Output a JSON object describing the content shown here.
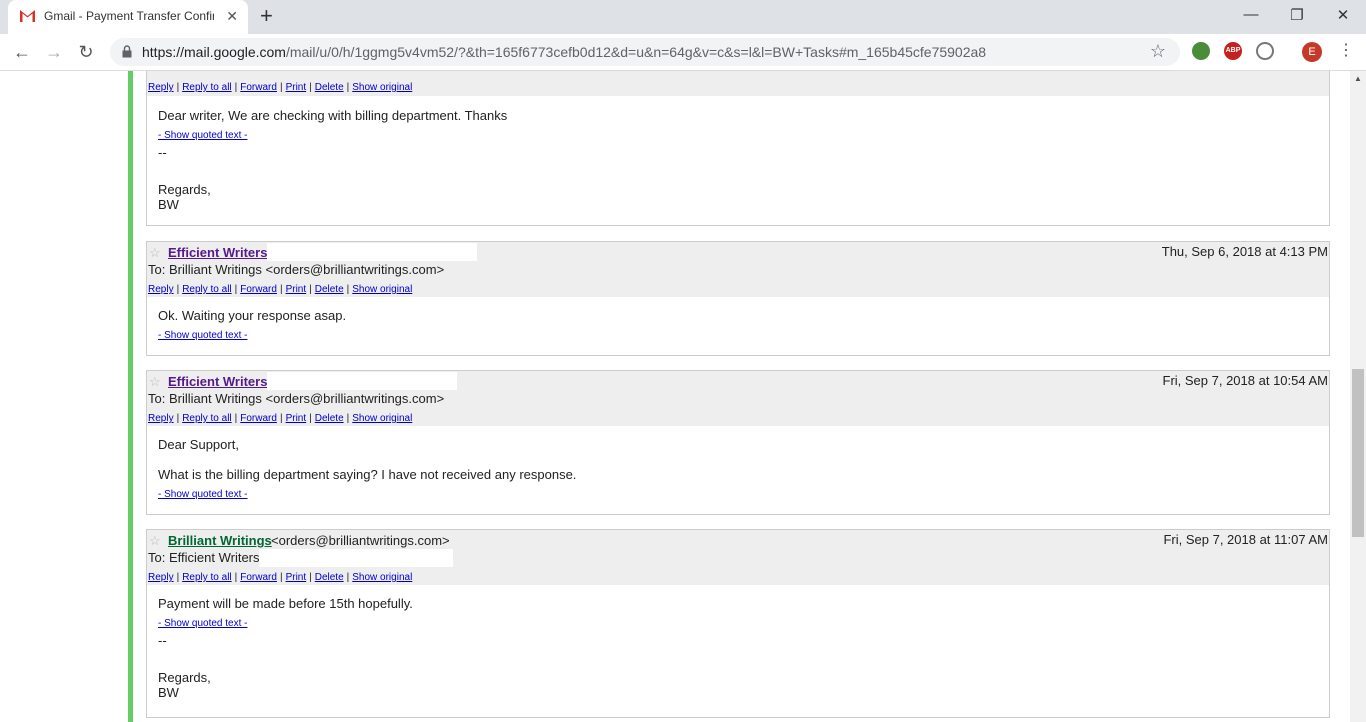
{
  "browser": {
    "tab_title": "Gmail - Payment Transfer Confirm",
    "tab_close": "✕",
    "new_tab": "+",
    "url_host": "https://mail.google.com",
    "url_path": "/mail/u/0/h/1ggmg5v4vm52/?&th=165f6773cefb0d12&d=u&n=64g&v=c&s=l&l=BW+Tasks#m_165b45cfe75902a8",
    "avatar_letter": "E",
    "abp_label": "ABP",
    "icons": [
      "back-icon",
      "forward-icon",
      "reload-icon",
      "lock-icon",
      "star-icon",
      "kebab-menu-icon"
    ]
  },
  "actions": {
    "reply": "Reply",
    "reply_all": "Reply to all",
    "forward": "Forward",
    "print": "Print",
    "delete": "Delete",
    "show_original": "Show original",
    "sep": "|"
  },
  "messages": [
    {
      "body": "Dear writer, We are checking with billing department. Thanks",
      "show_quoted": "- Show quoted text -",
      "sig_dash": "--",
      "sig_regards": "Regards,",
      "sig_name": "BW"
    },
    {
      "sender": "Efficient Writers",
      "date": "Thu, Sep 6, 2018 at 4:13 PM",
      "to": "To: Brilliant Writings <orders@brilliantwritings.com>",
      "body": "Ok. Waiting your response asap.",
      "show_quoted": "- Show quoted text -"
    },
    {
      "sender": "Efficient Writers",
      "date": "Fri, Sep 7, 2018 at 10:54 AM",
      "to": "To: Brilliant Writings <orders@brilliantwritings.com>",
      "body_line1": "Dear Support,",
      "body_line2": "What is the billing department saying? I have not received any response.",
      "show_quoted": "- Show quoted text -"
    },
    {
      "sender": "Brilliant Writings",
      "sender_email": "<orders@brilliantwritings.com>",
      "date": "Fri, Sep 7, 2018 at 11:07 AM",
      "to": "To: Efficient Writers",
      "body": "Payment will be made before 15th hopefully.",
      "show_quoted": "- Show quoted text -",
      "sig_dash": "--",
      "sig_regards": "Regards,",
      "sig_name": "BW"
    }
  ],
  "colors": {
    "thread_bar": "#66cc66",
    "header_bg": "#eeeeee",
    "link": "#0000cc",
    "sender_other": "#551a8b",
    "sender_self": "#006633"
  }
}
